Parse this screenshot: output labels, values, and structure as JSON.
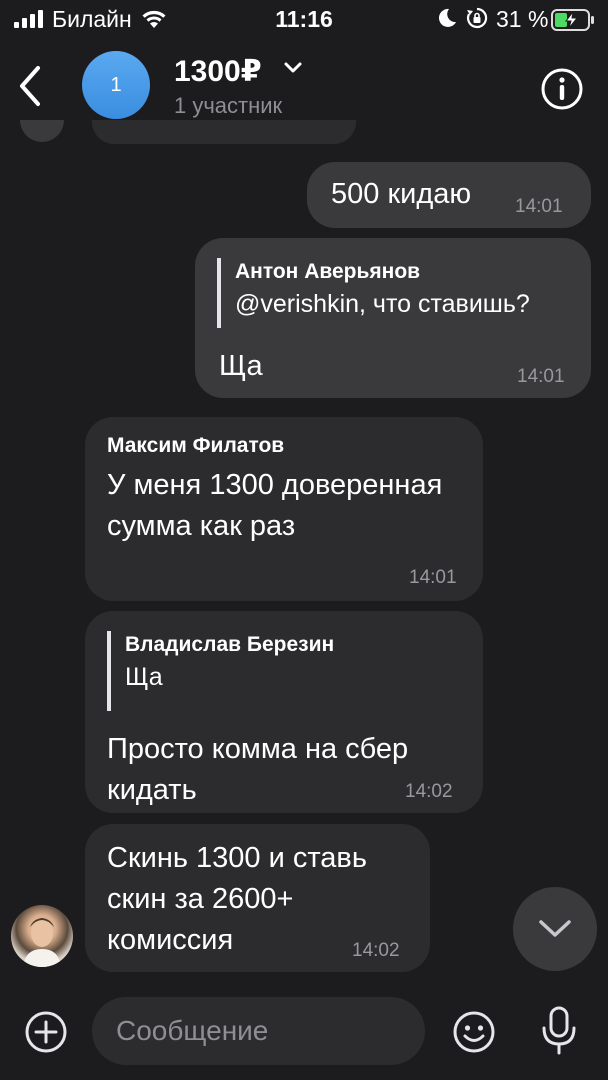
{
  "status_bar": {
    "carrier": "Билайн",
    "time": "11:16",
    "battery": "31 %"
  },
  "header": {
    "avatar_text": "1",
    "title": "1300₽",
    "subtitle": "1 участник"
  },
  "messages": [
    {
      "direction": "out",
      "text": "500 кидаю",
      "time": "14:01"
    },
    {
      "direction": "out",
      "reply_author": "Антон Аверьянов",
      "reply_text": "@verishkin, что ставишь?",
      "text": "Ща",
      "time": "14:01"
    },
    {
      "direction": "in",
      "sender": "Максим Филатов",
      "text": "У меня 1300 доверенная сумма как раз",
      "time": "14:01"
    },
    {
      "direction": "in",
      "reply_author": "Владислав Березин",
      "reply_text": "Ща",
      "text": "Просто комма на сбер кидать",
      "time": "14:02"
    },
    {
      "direction": "in",
      "text": "Скинь 1300 и ставь скин за 2600+ комиссия",
      "time": "14:02"
    }
  ],
  "input": {
    "placeholder": "Сообщение"
  },
  "icons": {
    "signal": "signal-icon",
    "wifi": "wifi-icon",
    "moon": "moon-icon",
    "rotation_lock": "rotation-lock-icon",
    "battery": "battery-charging-icon",
    "back": "chevron-left-icon",
    "dropdown": "chevron-down-icon",
    "info": "info-icon",
    "scroll_down": "chevron-down-icon",
    "add": "plus-circle-icon",
    "emoji": "smile-icon",
    "mic": "microphone-icon"
  },
  "colors": {
    "background": "#1c1c1e",
    "outgoing_bubble": "#3a3a3c",
    "incoming_bubble": "#2c2c2e",
    "chat_avatar": "#4a9be8",
    "battery_charging": "#4cd964",
    "secondary_text": "#8e8e93"
  }
}
